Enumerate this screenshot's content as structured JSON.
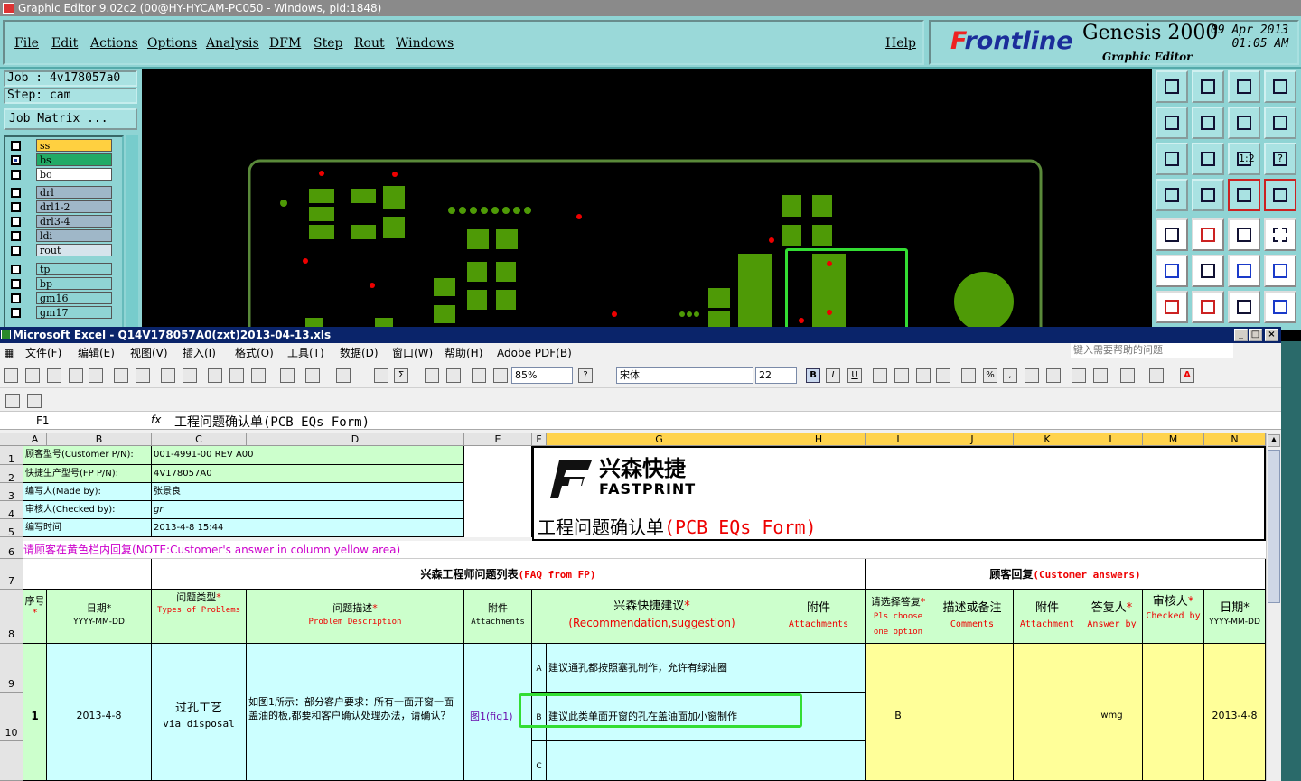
{
  "genesis": {
    "title": "Graphic Editor 9.02c2 (00@HY-HYCAM-PC050 - Windows, pid:1848)",
    "menu": [
      "File",
      "Edit",
      "Actions",
      "Options",
      "Analysis",
      "DFM",
      "Step",
      "Rout",
      "Windows"
    ],
    "help": "Help",
    "brand": "Frontline",
    "product": "Genesis 2000",
    "subtitle": "Graphic Editor",
    "date": "09 Apr 2013",
    "time": "01:05 AM",
    "job": "Job : 4v178057a0",
    "step": "Step: cam",
    "job_matrix": "Job Matrix ...",
    "layers": [
      "ss",
      "bs",
      "bo",
      "drl",
      "drl1-2",
      "drl3-4",
      "ldi",
      "rout",
      "tp",
      "bp",
      "gm16",
      "gm17"
    ]
  },
  "excel": {
    "title": "Microsoft Excel - Q14V178057A0(zxt)2013-04-13.xls",
    "menu": [
      "文件(F)",
      "编辑(E)",
      "视图(V)",
      "插入(I)",
      "格式(O)",
      "工具(T)",
      "数据(D)",
      "窗口(W)",
      "帮助(H)",
      "Adobe PDF(B)"
    ],
    "help_placeholder": "键入需要帮助的问题",
    "zoom": "85%",
    "font": "宋体",
    "font_size": "22",
    "name_box": "F1",
    "fx": "fx",
    "formula": "工程问题确认单(PCB EQs Form)",
    "columns": [
      "A",
      "B",
      "C",
      "D",
      "E",
      "F",
      "G",
      "H",
      "I",
      "J",
      "K",
      "L",
      "M",
      "N"
    ],
    "rows": [
      "1",
      "2",
      "3",
      "4",
      "5",
      "6",
      "7",
      "8",
      "9",
      "10"
    ],
    "info_labels": [
      "顾客型号(Customer P/N):",
      "快捷生产型号(FP P/N):",
      "编写人(Made by):",
      "审核人(Checked by):",
      "编写时间"
    ],
    "info_values": [
      "001-4991-00 REV A00",
      "4V178057A0",
      "张景良",
      "gr",
      "2013-4-8 15:44"
    ],
    "logo_cn": "兴森快捷",
    "logo_en": "FASTPRINT",
    "form_title_cn": "工程问题确认单",
    "form_title_en": "(PCB EQs Form)",
    "note": "请顾客在黄色栏内回复",
    "note_en": "(NOTE:Customer's answer in column yellow area)",
    "faq_cn": "兴森工程师问题列表",
    "faq_en": "(FAQ from FP)",
    "cust_cn": "顾客回复",
    "cust_en": "(Customer answers)",
    "headers": {
      "seq": "序号",
      "date": "日期",
      "date_fmt": "YYYY-MM-DD",
      "type_cn": "问题类型",
      "type_en": "Types of Problems",
      "desc_cn": "问题描述",
      "desc_en": "Problem Description",
      "att_cn": "附件",
      "att_en": "Attachments",
      "rec_cn": "兴森快捷建议",
      "rec_en": "(Recommendation,suggestion)",
      "choose_cn": "请选择答复",
      "choose_en": "Pls choose one option",
      "comm_cn": "描述或备注",
      "comm_en": "Comments",
      "att2_en": "Attachment",
      "ans_cn": "答复人",
      "ans_en": "Answer by",
      "chk_cn": "审核人",
      "chk_en": "Checked by"
    },
    "row1": {
      "seq": "1",
      "date": "2013-4-8",
      "type_cn": "过孔工艺",
      "type_en": "via disposal",
      "desc": "如图1所示：部分客户要求：所有一面开窗一面盖油的板,都要和客户确认处理办法，请确认？",
      "att": "图1(fig1)",
      "opt_a": "A",
      "rec_a": "建议通孔都按照塞孔制作，允许有绿油圈",
      "opt_b": "B",
      "rec_b": "建议此类单面开窗的孔在盖油面加小窗制作",
      "opt_c": "C",
      "choice": "B",
      "answer_by": "wmg",
      "cust_date": "2013-4-8"
    }
  }
}
